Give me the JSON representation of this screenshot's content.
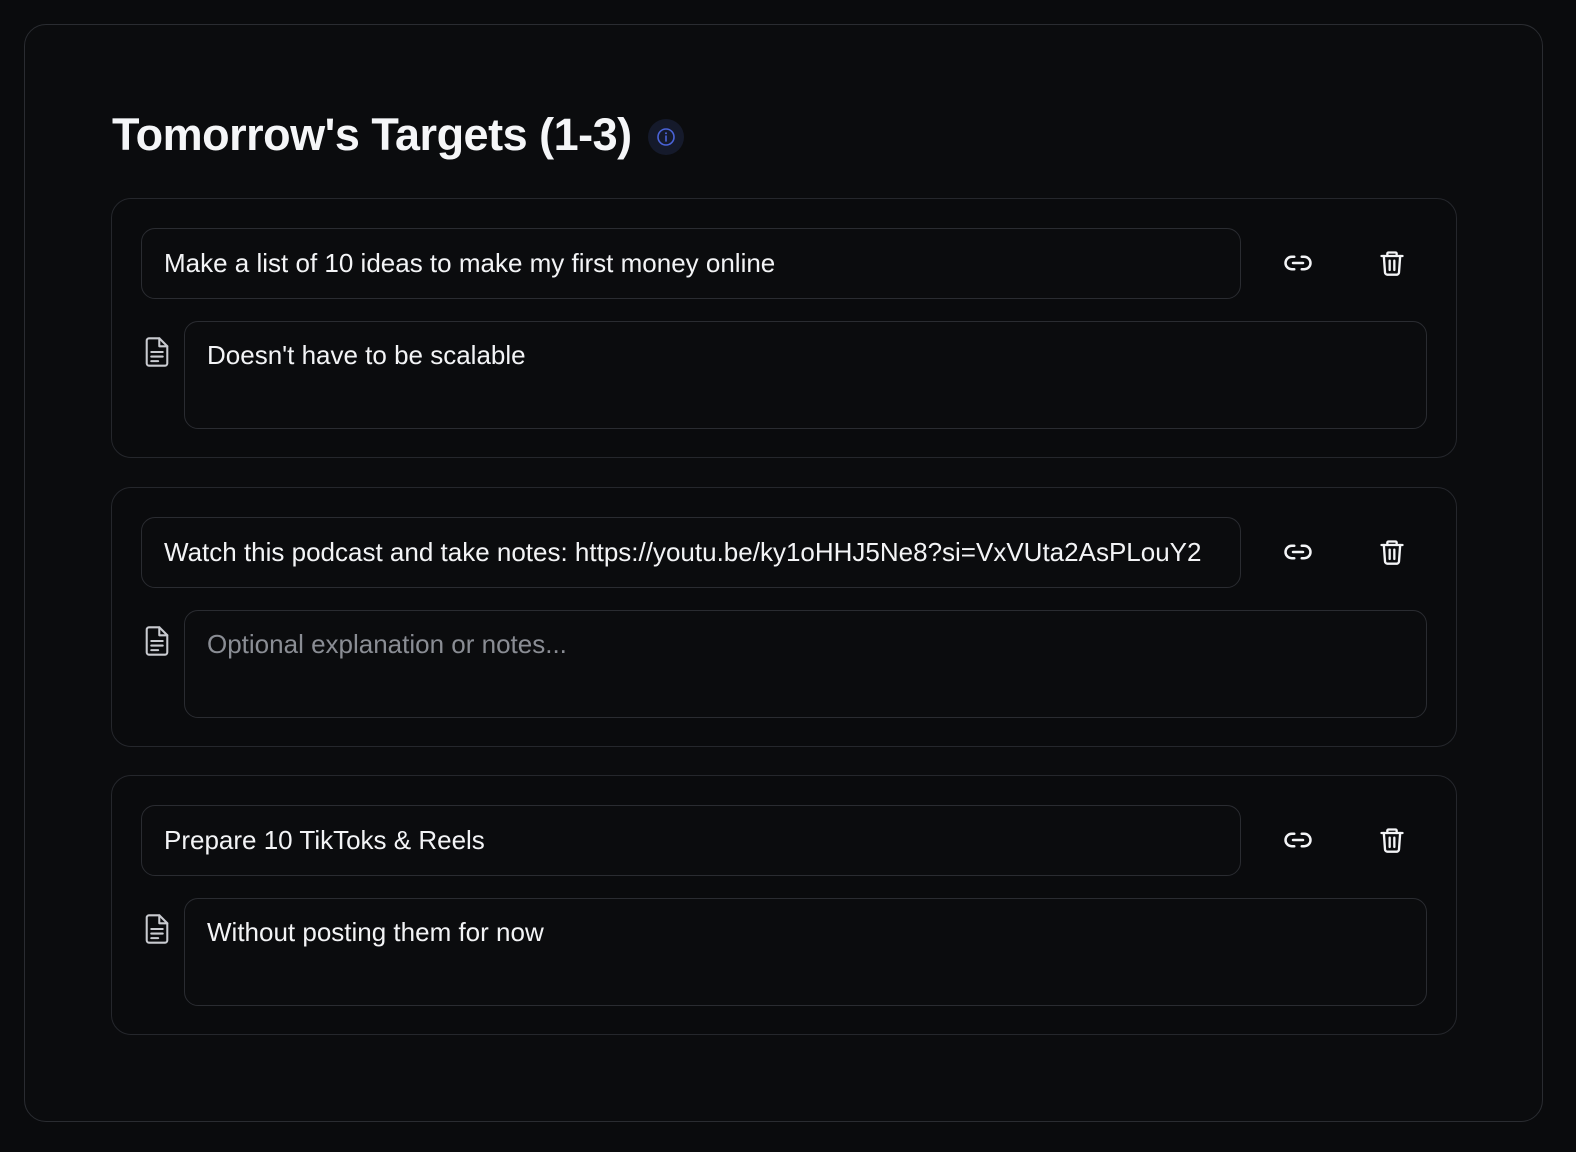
{
  "header": {
    "title": "Tomorrow's Targets (1-3)",
    "info_icon": "info-circle-icon",
    "info_color": "#4a63d8"
  },
  "targets": [
    {
      "text": "Make a list of 10 ideas to make my first money online",
      "notes": "Doesn't have to be scalable",
      "notes_placeholder": "Optional explanation or notes..."
    },
    {
      "text": "Watch this podcast and take notes: https://youtu.be/ky1oHHJ5Ne8?si=VxVUta2AsPLouY2",
      "notes": "",
      "notes_placeholder": "Optional explanation or notes..."
    },
    {
      "text": "Prepare 10 TikToks & Reels",
      "notes": "Without posting them for now",
      "notes_placeholder": "Optional explanation or notes..."
    }
  ],
  "icons": {
    "link": "link-icon",
    "delete": "trash-icon",
    "note": "document-icon"
  }
}
